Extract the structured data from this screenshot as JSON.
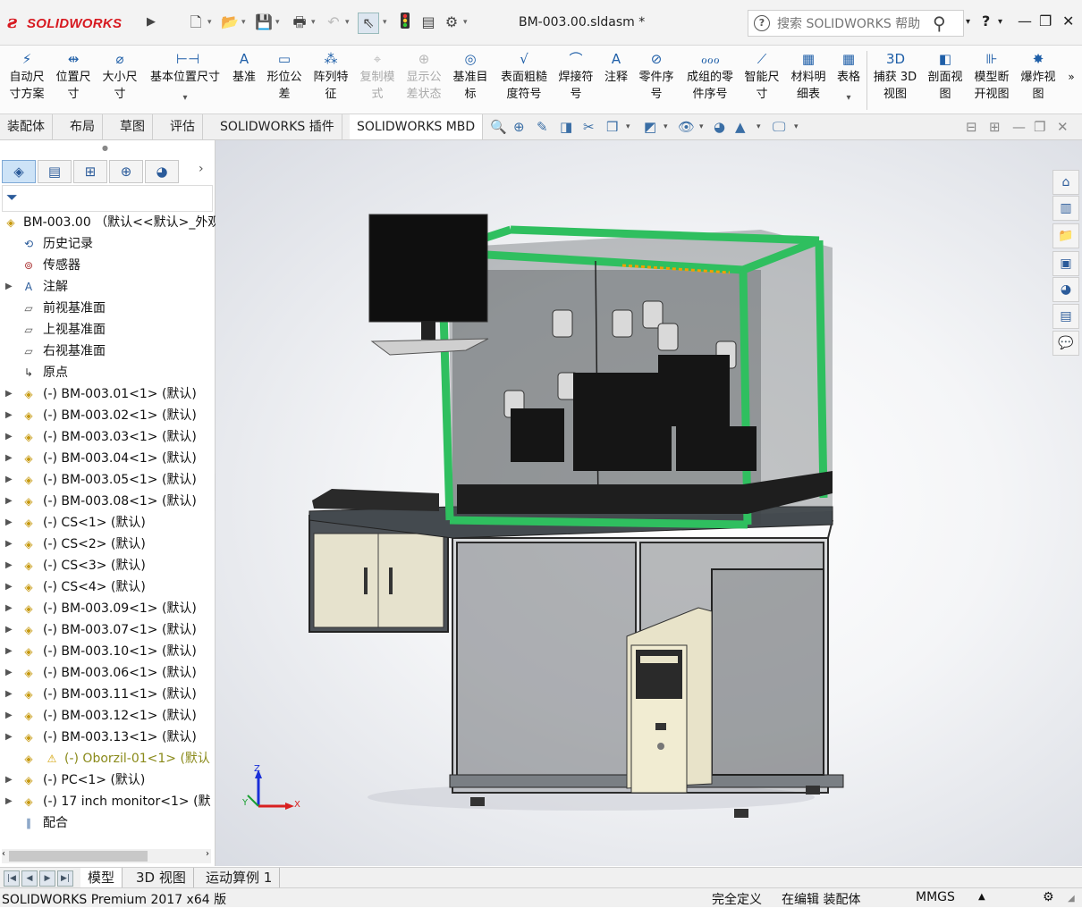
{
  "app": {
    "brand": "SOLIDWORKS",
    "doc_title": "BM-003.00.sldasm *"
  },
  "help_search": {
    "placeholder": "搜索 SOLIDWORKS 帮助",
    "help": "?"
  },
  "ribbon": {
    "buttons": [
      {
        "label": "自动尺\n寸方案",
        "icon": "smart-dimension-icon",
        "enabled": true
      },
      {
        "label": "位置尺\n寸",
        "icon": "location-dimension-icon",
        "enabled": true
      },
      {
        "label": "大小尺\n寸",
        "icon": "size-dimension-icon",
        "enabled": true
      },
      {
        "label": "基本位置尺寸",
        "icon": "basic-location-dimension-icon",
        "enabled": true
      },
      {
        "label": "基准",
        "icon": "datum-icon",
        "enabled": true
      },
      {
        "label": "形位公\n差",
        "icon": "geometric-tolerance-icon",
        "enabled": true
      },
      {
        "label": "阵列特\n征",
        "icon": "pattern-feature-icon",
        "enabled": true
      },
      {
        "label": "复制模\n式",
        "icon": "copy-scheme-icon",
        "enabled": false
      },
      {
        "label": "显示公\n差状态",
        "icon": "show-tolerance-status-icon",
        "enabled": false
      },
      {
        "label": "基准目\n标",
        "icon": "datum-target-icon",
        "enabled": true
      },
      {
        "label": "表面粗糙\n度符号",
        "icon": "surface-finish-icon",
        "enabled": true
      },
      {
        "label": "焊接符\n号",
        "icon": "weld-symbol-icon",
        "enabled": true
      },
      {
        "label": "注释",
        "icon": "note-icon",
        "enabled": true
      },
      {
        "label": "零件序\n号",
        "icon": "balloon-icon",
        "enabled": true
      },
      {
        "label": "成组的零\n件序号",
        "icon": "stacked-balloon-icon",
        "enabled": true
      },
      {
        "label": "智能尺\n寸",
        "icon": "smart-dim-icon",
        "enabled": true
      },
      {
        "label": "材料明\n细表",
        "icon": "bom-icon",
        "enabled": true
      },
      {
        "label": "表格",
        "icon": "table-icon",
        "enabled": true
      },
      {
        "label": "捕获 3D\n视图",
        "icon": "capture-3d-view-icon",
        "enabled": true
      },
      {
        "label": "剖面视\n图",
        "icon": "section-view-icon",
        "enabled": true
      },
      {
        "label": "模型断\n开视图",
        "icon": "broken-view-icon",
        "enabled": true
      },
      {
        "label": "爆炸视\n图",
        "icon": "exploded-view-icon",
        "enabled": true
      }
    ]
  },
  "command_tabs": [
    "装配体",
    "布局",
    "草图",
    "评估",
    "SOLIDWORKS 插件",
    "SOLIDWORKS MBD"
  ],
  "active_command_tab": "SOLIDWORKS MBD",
  "feature_tree": {
    "root": "BM-003.00 （默认<<默认>_外观",
    "items": [
      {
        "label": "历史记录",
        "icon": "history-icon",
        "expandable": false
      },
      {
        "label": "传感器",
        "icon": "sensor-icon",
        "expandable": false
      },
      {
        "label": "注解",
        "icon": "annotation-icon",
        "expandable": true
      },
      {
        "label": "前视基准面",
        "icon": "plane-icon",
        "expandable": false
      },
      {
        "label": "上视基准面",
        "icon": "plane-icon",
        "expandable": false
      },
      {
        "label": "右视基准面",
        "icon": "plane-icon",
        "expandable": false
      },
      {
        "label": "原点",
        "icon": "origin-icon",
        "expandable": false
      },
      {
        "label": "(-) BM-003.01<1> (默认)",
        "icon": "subassembly-icon",
        "expandable": true
      },
      {
        "label": "(-) BM-003.02<1> (默认)",
        "icon": "subassembly-icon",
        "expandable": true
      },
      {
        "label": "(-) BM-003.03<1> (默认)",
        "icon": "subassembly-icon",
        "expandable": true
      },
      {
        "label": "(-) BM-003.04<1> (默认)",
        "icon": "subassembly-icon",
        "expandable": true
      },
      {
        "label": "(-) BM-003.05<1> (默认)",
        "icon": "subassembly-icon",
        "expandable": true
      },
      {
        "label": "(-) BM-003.08<1> (默认)",
        "icon": "subassembly-icon",
        "expandable": true
      },
      {
        "label": "(-) CS<1> (默认)",
        "icon": "subassembly-icon",
        "expandable": true
      },
      {
        "label": "(-) CS<2> (默认)",
        "icon": "subassembly-icon",
        "expandable": true
      },
      {
        "label": "(-) CS<3> (默认)",
        "icon": "subassembly-icon",
        "expandable": true
      },
      {
        "label": "(-) CS<4> (默认)",
        "icon": "subassembly-icon",
        "expandable": true
      },
      {
        "label": "(-) BM-003.09<1> (默认)",
        "icon": "subassembly-icon",
        "expandable": true
      },
      {
        "label": "(-) BM-003.07<1> (默认)",
        "icon": "subassembly-icon",
        "expandable": true
      },
      {
        "label": "(-) BM-003.10<1> (默认)",
        "icon": "subassembly-icon",
        "expandable": true
      },
      {
        "label": "(-) BM-003.06<1> (默认)",
        "icon": "subassembly-icon",
        "expandable": true
      },
      {
        "label": "(-) BM-003.11<1> (默认)",
        "icon": "subassembly-icon",
        "expandable": true
      },
      {
        "label": "(-) BM-003.12<1> (默认)",
        "icon": "subassembly-icon",
        "expandable": true
      },
      {
        "label": "(-) BM-003.13<1> (默认)",
        "icon": "subassembly-icon",
        "expandable": true
      },
      {
        "label": "(-) Oborzil-01<1> (默认",
        "icon": "warning-icon",
        "expandable": false,
        "warning": true
      },
      {
        "label": "(-) PC<1> (默认)",
        "icon": "subassembly-icon",
        "expandable": true
      },
      {
        "label": "(-) 17 inch monitor<1> (默",
        "icon": "subassembly-icon",
        "expandable": true
      },
      {
        "label": "配合",
        "icon": "mates-icon",
        "expandable": false
      }
    ]
  },
  "bottom_tabs": [
    "模型",
    "3D 视图",
    "运动算例 1"
  ],
  "active_bottom_tab": "模型",
  "status": {
    "product": "SOLIDWORKS Premium 2017 x64 版",
    "definition": "完全定义",
    "mode": "在编辑 装配体",
    "units": "MMGS"
  },
  "triad": {
    "x": "X",
    "y": "Y",
    "z": "Z"
  },
  "colors": {
    "frame_green": "#2fbf5f",
    "brand_red": "#d71920",
    "selection_blue": "#cde3f7"
  }
}
